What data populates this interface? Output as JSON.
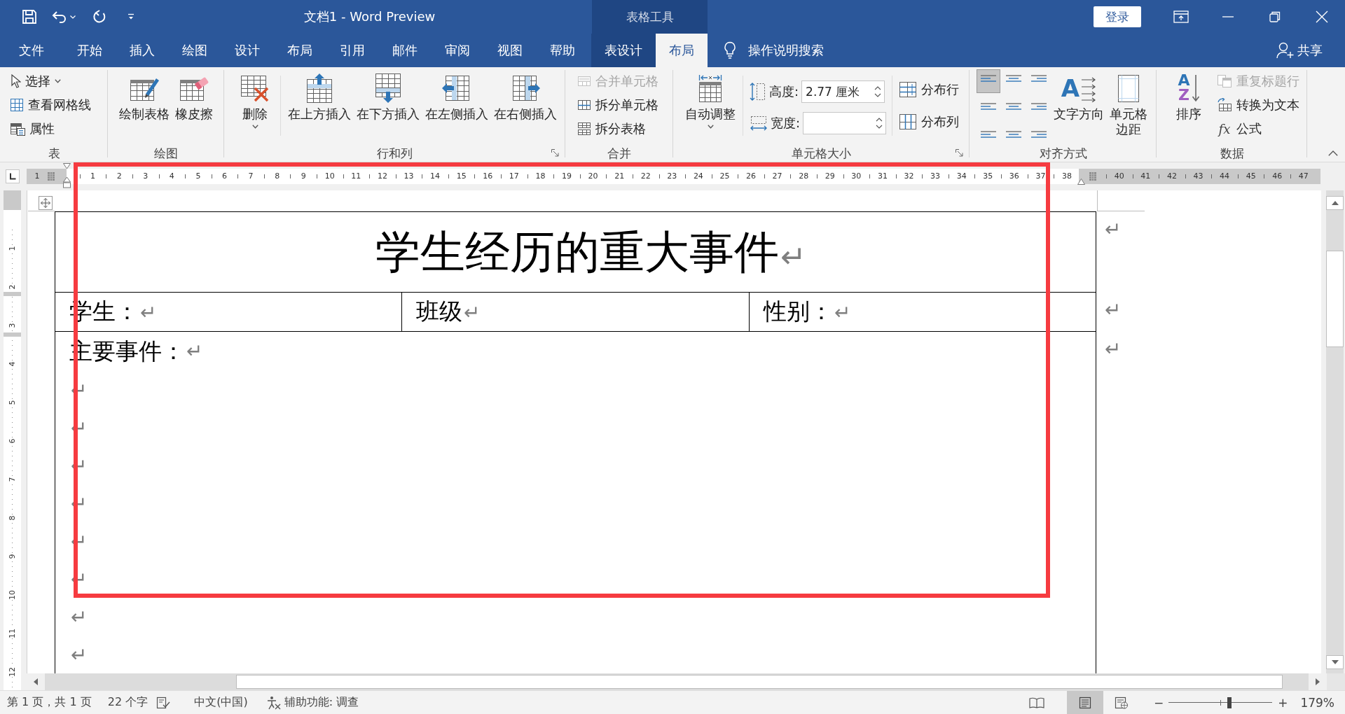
{
  "title_bar": {
    "title": "文档1 - Word Preview",
    "context_label": "表格工具",
    "sign_in": "登录"
  },
  "tabs": [
    {
      "label": "文件",
      "selected": false,
      "contextual": false
    },
    {
      "label": "开始",
      "selected": false,
      "contextual": false
    },
    {
      "label": "插入",
      "selected": false,
      "contextual": false
    },
    {
      "label": "绘图",
      "selected": false,
      "contextual": false
    },
    {
      "label": "设计",
      "selected": false,
      "contextual": false
    },
    {
      "label": "布局",
      "selected": false,
      "contextual": false
    },
    {
      "label": "引用",
      "selected": false,
      "contextual": false
    },
    {
      "label": "邮件",
      "selected": false,
      "contextual": false
    },
    {
      "label": "审阅",
      "selected": false,
      "contextual": false
    },
    {
      "label": "视图",
      "selected": false,
      "contextual": false
    },
    {
      "label": "帮助",
      "selected": false,
      "contextual": false
    },
    {
      "label": "表设计",
      "selected": false,
      "contextual": true
    },
    {
      "label": "布局",
      "selected": true,
      "contextual": true
    }
  ],
  "tell_me": "操作说明搜索",
  "share": "共享",
  "ribbon": {
    "table": {
      "label": "表",
      "commands": [
        {
          "label": "选择",
          "dropdown": true
        },
        {
          "label": "查看网格线",
          "dropdown": false
        },
        {
          "label": "属性",
          "dropdown": false
        }
      ]
    },
    "draw": {
      "label": "绘图",
      "commands": [
        {
          "label": "绘制表格"
        },
        {
          "label": "橡皮擦"
        }
      ]
    },
    "rows_columns": {
      "label": "行和列",
      "launcher": true,
      "delete": {
        "label": "删除",
        "dropdown": true
      },
      "commands": [
        {
          "label": "在上方插入"
        },
        {
          "label": "在下方插入"
        },
        {
          "label": "在左侧插入"
        },
        {
          "label": "在右侧插入"
        }
      ]
    },
    "merge": {
      "label": "合并",
      "commands": [
        {
          "label": "合并单元格",
          "disabled": true
        },
        {
          "label": "拆分单元格",
          "disabled": false
        },
        {
          "label": "拆分表格",
          "disabled": false
        }
      ]
    },
    "cell_size": {
      "label": "单元格大小",
      "launcher": true,
      "autofit": {
        "label": "自动调整",
        "dropdown": true
      },
      "fields": [
        {
          "label": "高度:",
          "value": "2.77 厘米"
        },
        {
          "label": "宽度:"
        }
      ],
      "commands": [
        {
          "label": "分布行"
        },
        {
          "label": "分布列"
        }
      ]
    },
    "alignment": {
      "label": "对齐方式",
      "cells": [
        {
          "kind": "top-left",
          "selected": true
        },
        {
          "kind": "top-center",
          "selected": false
        },
        {
          "kind": "top-right",
          "selected": false
        },
        {
          "kind": "middle-left",
          "selected": false
        },
        {
          "kind": "middle-center",
          "selected": false
        },
        {
          "kind": "middle-right",
          "selected": false
        },
        {
          "kind": "bottom-left",
          "selected": false
        },
        {
          "kind": "bottom-center",
          "selected": false
        },
        {
          "kind": "bottom-right",
          "selected": false
        }
      ],
      "text_direction": {
        "label": "文字方向",
        "glyph": "A"
      },
      "cell_margins": {
        "label": "单元格边距"
      }
    },
    "data": {
      "label": "数据",
      "sort": {
        "label": "排序",
        "glyphs": [
          "A",
          "Z"
        ]
      },
      "commands": [
        {
          "label": "重复标题行",
          "disabled": true
        },
        {
          "label": "转换为文本",
          "disabled": false
        },
        {
          "label": "公式",
          "disabled": false,
          "glyph": "fx"
        }
      ]
    }
  },
  "ruler": {
    "left_numbers": [
      "1"
    ],
    "numbers": [
      "1",
      "2",
      "3",
      "4",
      "5",
      "6",
      "7",
      "8",
      "9",
      "10",
      "11",
      "12",
      "13",
      "14",
      "15",
      "16",
      "17",
      "18",
      "19",
      "20",
      "21",
      "22",
      "23",
      "24",
      "25",
      "26",
      "27",
      "28",
      "29",
      "30",
      "31",
      "32",
      "33",
      "34",
      "35",
      "36",
      "37",
      "38"
    ],
    "right_numbers": [
      "40",
      "41",
      "42",
      "43",
      "44",
      "45",
      "46",
      "47"
    ]
  },
  "vertical_ruler": {
    "numbers": [
      "1",
      "2",
      "3",
      "4",
      "5",
      "6",
      "7",
      "8",
      "9",
      "10",
      "11",
      "12"
    ]
  },
  "document": {
    "table": {
      "title": {
        "text": "学生经历的重大事件",
        "mark": "↵"
      },
      "info": [
        {
          "text": "学生：",
          "mark": "↵"
        },
        {
          "text": "班级",
          "mark": "↵"
        },
        {
          "text": "性别：",
          "mark": "↵"
        }
      ],
      "events": {
        "text": "主要事件：",
        "mark": "↵",
        "empty_lines": [
          "↵",
          "↵",
          "↵",
          "↵",
          "↵",
          "↵",
          "↵",
          "↵"
        ]
      },
      "row_end_marks": [
        "↵",
        "↵",
        "↵"
      ]
    }
  },
  "status_bar": {
    "page": "第 1 页，共 1 页",
    "words": "22 个字",
    "language": "中文(中国)",
    "accessibility": "辅助功能: 调查",
    "views": [
      {
        "kind": "read",
        "selected": false
      },
      {
        "kind": "print",
        "selected": true
      },
      {
        "kind": "web",
        "selected": false
      }
    ],
    "zoom": {
      "out": "−",
      "in": "+",
      "level": 0.59,
      "percent": "179%"
    }
  }
}
